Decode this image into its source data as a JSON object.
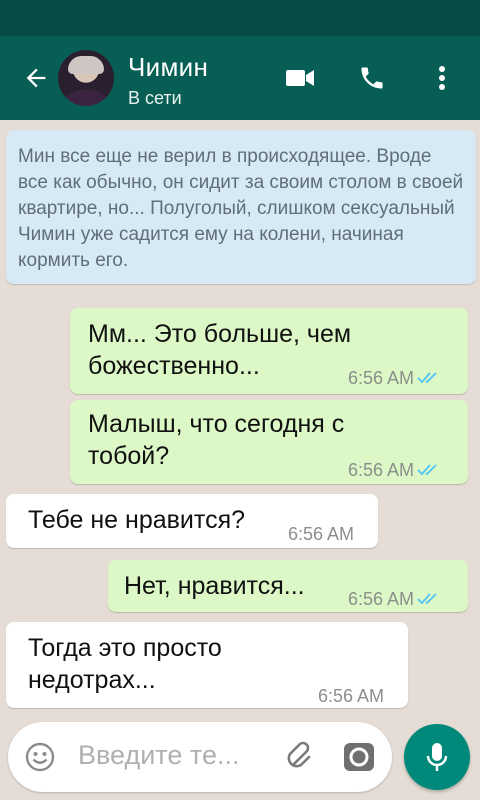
{
  "header": {
    "contact_name": "Чимин",
    "status": "В сети",
    "icons": [
      "back-arrow-icon",
      "video-call-icon",
      "voice-call-icon",
      "more-vert-icon"
    ]
  },
  "notice": {
    "text": "Мин все еще не верил в происходящее. Вроде все как обычно, он сидит за своим столом в своей квартире, но... Полуголый, слишком сексуальный Чимин уже садится ему на колени, начиная кормить его."
  },
  "messages": [
    {
      "direction": "outgoing",
      "line1": "Мм... Это больше, чем",
      "line2": "божественно...",
      "time": "6:56 AM",
      "read": true
    },
    {
      "direction": "outgoing",
      "line1": "Малыш, что сегодня с",
      "line2": "тобой?",
      "time": "6:56 AM",
      "read": true
    },
    {
      "direction": "incoming",
      "line1": "Тебе не нравится?",
      "time": "6:56 AM"
    },
    {
      "direction": "outgoing",
      "line1": "Нет, нравится...",
      "time": "6:56 AM",
      "read": true
    },
    {
      "direction": "incoming",
      "line1": "Тогда это просто",
      "line2": "недотрах...",
      "time": "6:56 AM"
    }
  ],
  "composer": {
    "placeholder": "Введите те..."
  },
  "colors": {
    "header": "#075e54",
    "status_bar": "#054d44",
    "outgoing_bubble": "#dcf8c6",
    "incoming_bubble": "#ffffff",
    "notice_bubble": "#d7e9f4",
    "read_ticks": "#4fc3f7",
    "mic_button": "#00897b"
  }
}
